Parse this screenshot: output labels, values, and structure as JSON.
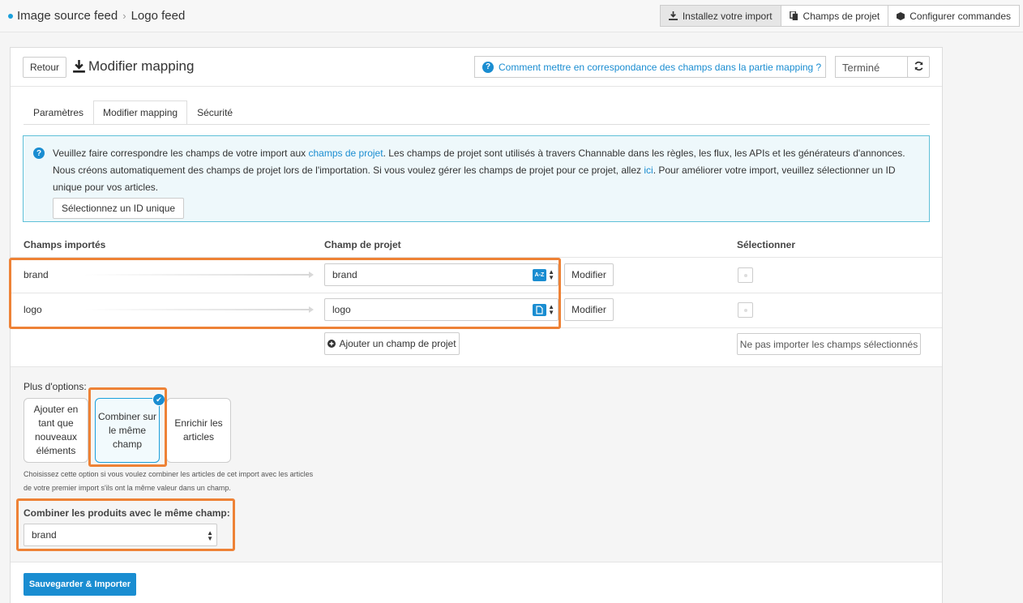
{
  "breadcrumb": {
    "parent": "Image source feed",
    "current": "Logo feed"
  },
  "topbar": {
    "install_label": "Installez votre import",
    "project_fields_label": "Champs de projet",
    "configure_label": "Configurer commandes"
  },
  "header": {
    "back_label": "Retour",
    "title": "Modifier mapping",
    "help_link": "Comment mettre en correspondance des champs dans la partie mapping ?",
    "status": "Terminé"
  },
  "tabs": [
    {
      "label": "Paramètres"
    },
    {
      "label": "Modifier mapping"
    },
    {
      "label": "Sécurité"
    }
  ],
  "info": {
    "text1": "Veuillez faire correspondre les champs de votre import aux ",
    "link1": "champs de projet",
    "text2": ". Les champs de projet sont utilisés à travers Channable dans les règles, les flux, les APIs et les générateurs d'annonces. Nous créons automatiquement des champs de projet lors de l'importation. Si vous voulez gérer les champs de projet pour ce projet, allez ",
    "link2": "ici",
    "text3": ". Pour améliorer votre import, veuillez sélectionner un ID unique pour vos articles.",
    "button": "Sélectionnez un ID unique"
  },
  "table": {
    "col_imported": "Champs importés",
    "col_project": "Champ de projet",
    "col_select": "Sélectionner",
    "rows": [
      {
        "imported": "brand",
        "project": "brand",
        "badge": "A-Z",
        "modify": "Modifier"
      },
      {
        "imported": "logo",
        "project": "logo",
        "badge": "doc",
        "modify": "Modifier"
      }
    ],
    "add_field": "Ajouter un champ de projet",
    "no_import": "Ne pas importer les champs sélectionnés"
  },
  "options": {
    "title": "Plus d'options:",
    "cards": [
      {
        "label": "Ajouter en tant que nouveaux éléments"
      },
      {
        "label": "Combiner sur le même champ",
        "selected": true
      },
      {
        "label": "Enrichir les articles"
      }
    ],
    "description": "Choisissez cette option si vous voulez combiner les articles de cet import avec les articles de votre premier import s'ils ont la même valeur dans un champ.",
    "combine_label": "Combiner les produits avec le même champ:",
    "combine_value": "brand"
  },
  "save_label": "Sauvegarder & Importer",
  "colors": {
    "accent": "#1a8dd1",
    "highlight": "#ee8236"
  }
}
